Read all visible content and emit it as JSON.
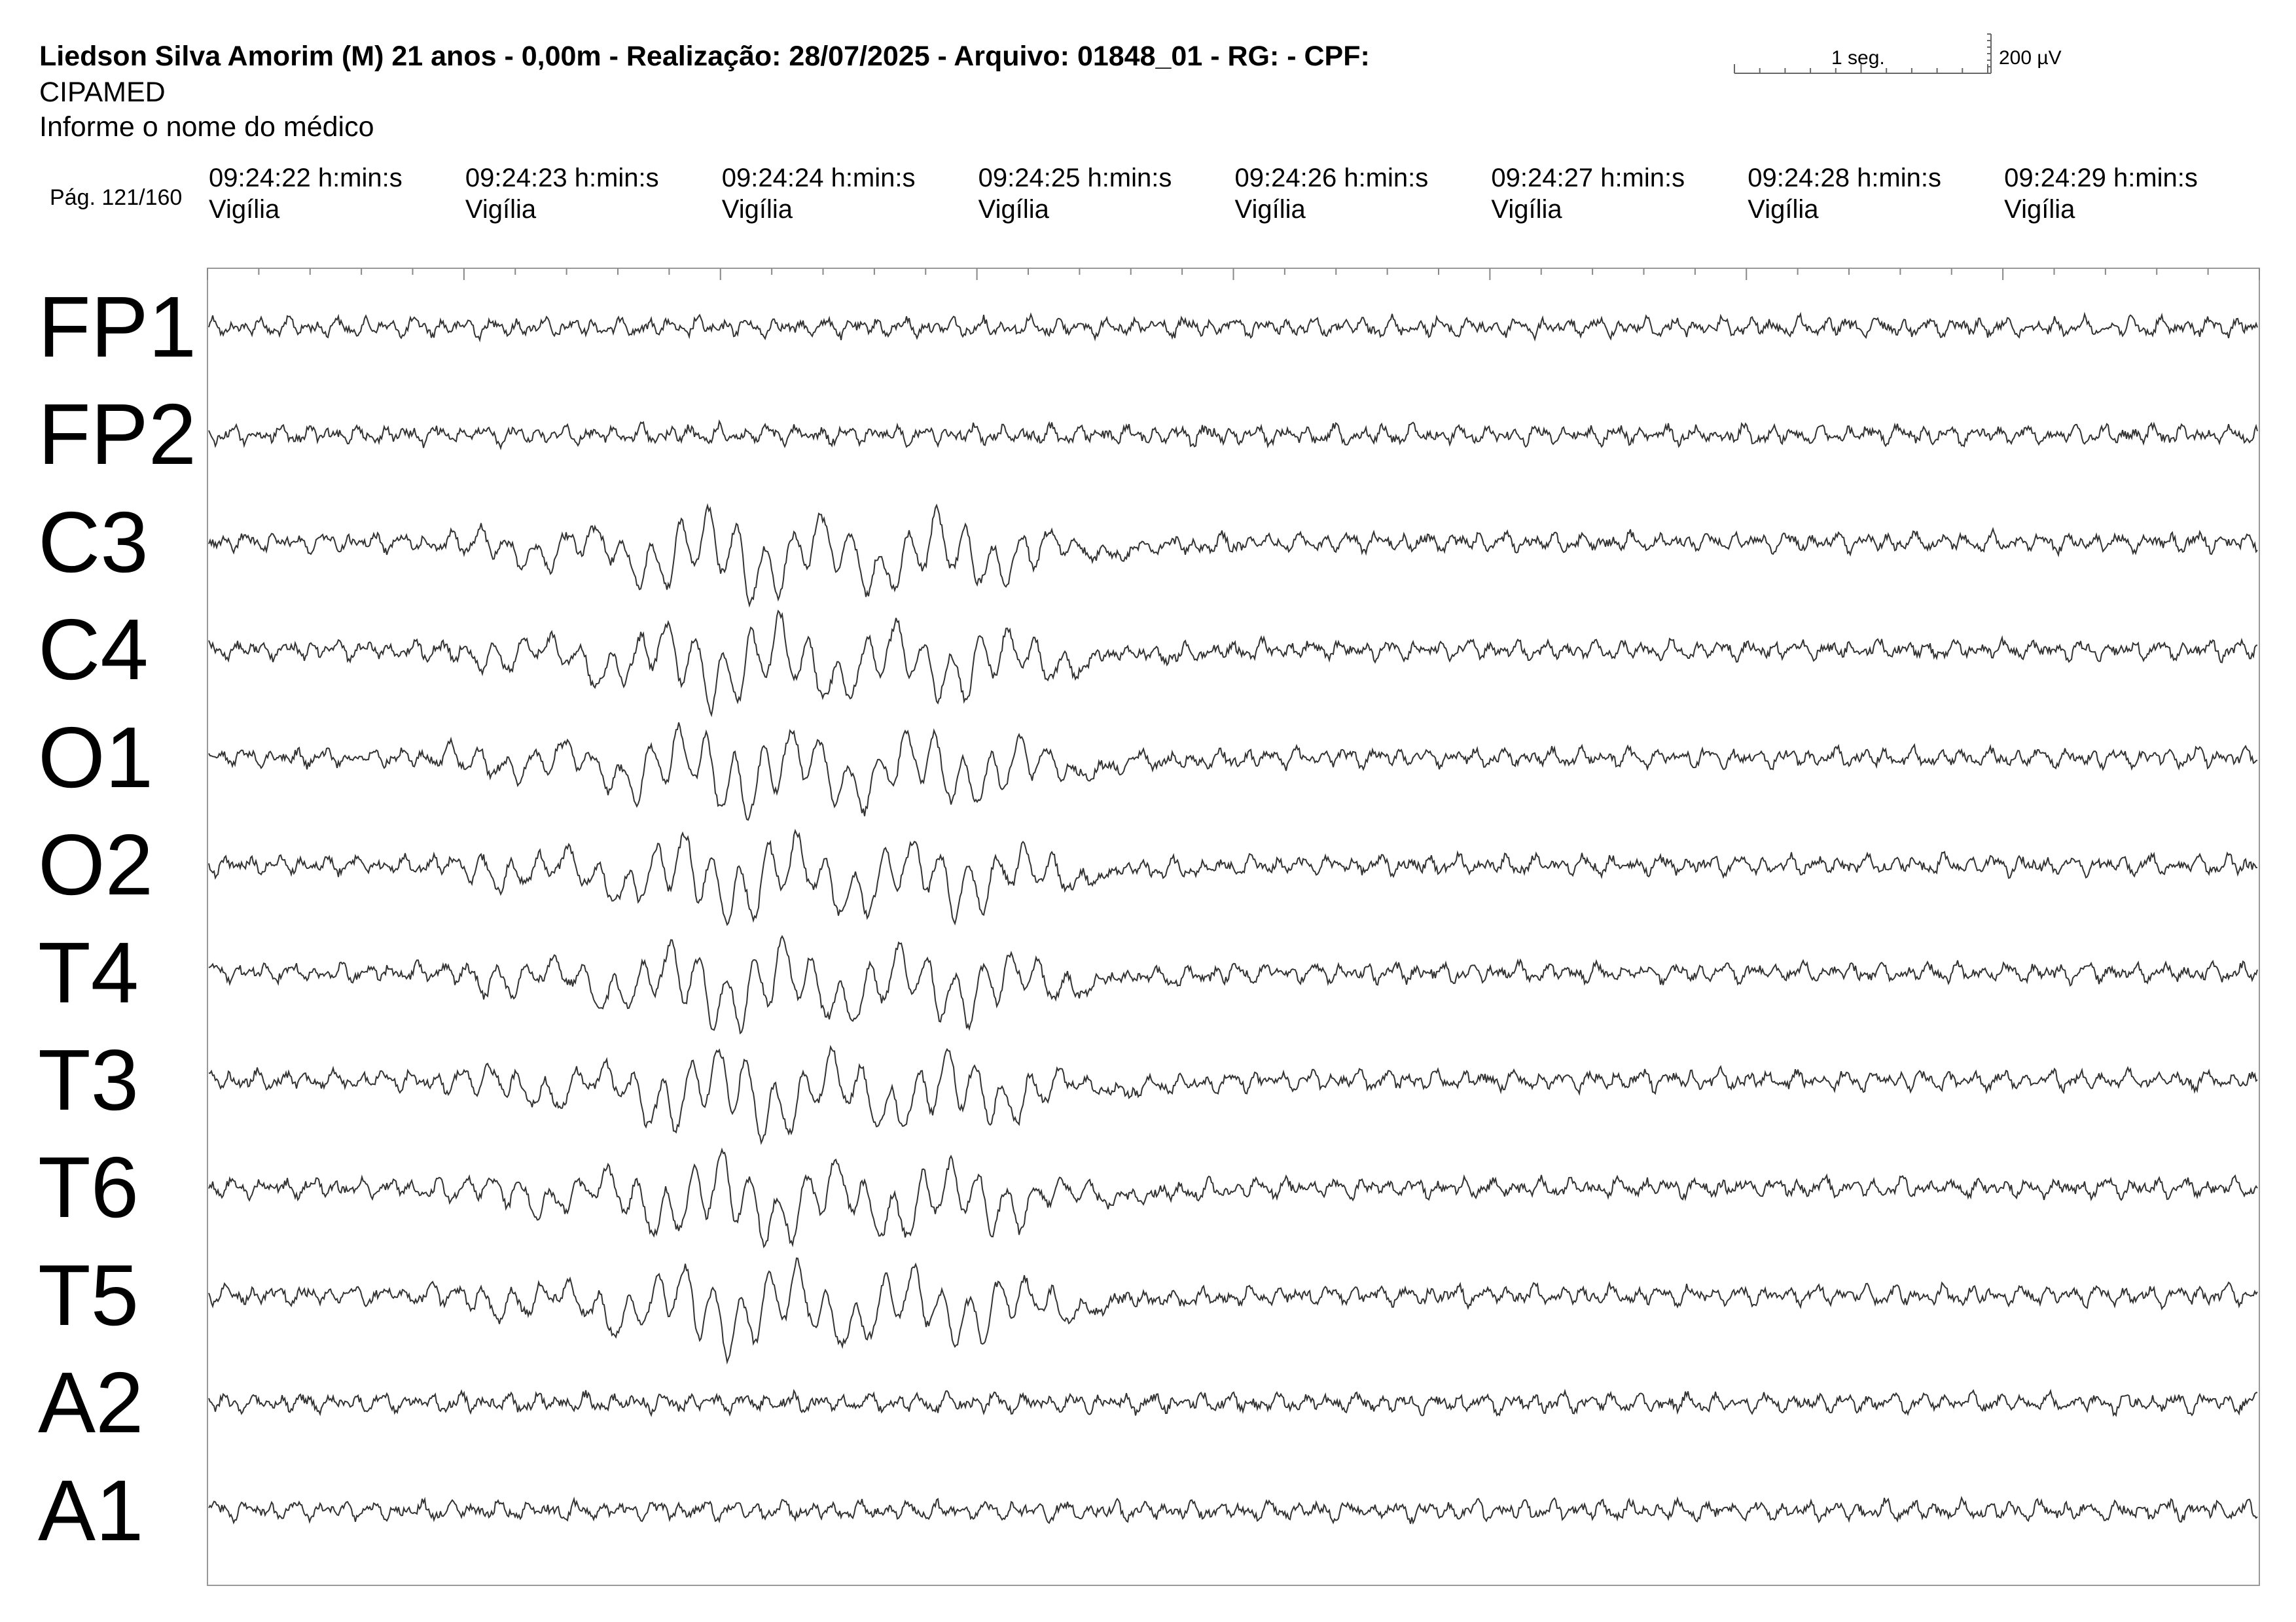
{
  "header": {
    "title": "Liedson Silva Amorim (M) 21 anos - 0,00m - Realização: 28/07/2025 - Arquivo: 01848_01 - RG:  - CPF:",
    "organization": "CIPAMED",
    "doctor": "Informe o nome do médico",
    "page": "Pág. 121/160"
  },
  "scale": {
    "time": "1 seg.",
    "amplitude": "200 µV"
  },
  "timestamps": [
    {
      "time": "09:24:22 h:min:s",
      "state": "Vigília"
    },
    {
      "time": "09:24:23 h:min:s",
      "state": "Vigília"
    },
    {
      "time": "09:24:24 h:min:s",
      "state": "Vigília"
    },
    {
      "time": "09:24:25 h:min:s",
      "state": "Vigília"
    },
    {
      "time": "09:24:26 h:min:s",
      "state": "Vigília"
    },
    {
      "time": "09:24:27 h:min:s",
      "state": "Vigília"
    },
    {
      "time": "09:24:28 h:min:s",
      "state": "Vigília"
    },
    {
      "time": "09:24:29 h:min:s",
      "state": "Vigília"
    }
  ],
  "chart_data": {
    "type": "line",
    "x_unit": "s",
    "x_range": [
      0,
      8
    ],
    "channels": [
      "FP1",
      "FP2",
      "C3",
      "C4",
      "O1",
      "O2",
      "T4",
      "T3",
      "T6",
      "T5",
      "A2",
      "A1"
    ],
    "events": [
      {
        "channels": [
          "C3",
          "C4",
          "O1",
          "O2",
          "T4",
          "T3",
          "T6",
          "T5"
        ],
        "start_s": 0.8,
        "end_s": 4.1,
        "pattern": "high-amplitude rhythmic discharge"
      }
    ]
  }
}
